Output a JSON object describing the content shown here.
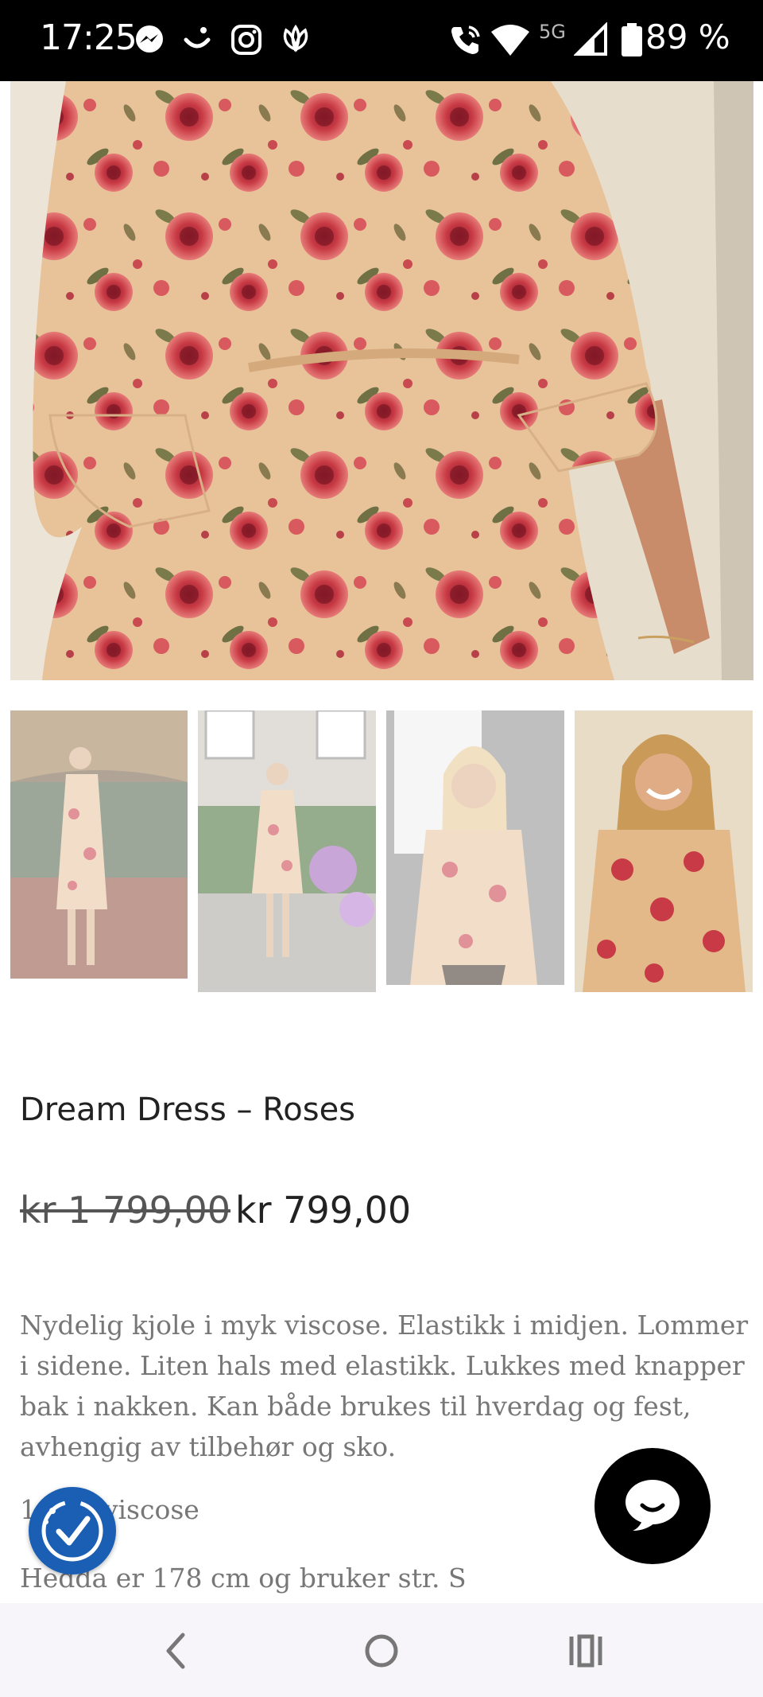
{
  "status_bar": {
    "time": "17:25",
    "network": "5G",
    "battery": "89 %",
    "left_icons": [
      "messenger-icon",
      "smile-icon",
      "instagram-icon",
      "flower-icon"
    ],
    "right_icons": [
      "wifi-call-icon",
      "wifi-icon",
      "signal-icon",
      "battery-icon"
    ]
  },
  "gallery": {
    "main_image": "floral-dress-closeup",
    "thumbnails": [
      "dress-outdoor-tropical",
      "dress-garden-walk",
      "dress-wall-portrait",
      "dress-smiling-portrait"
    ]
  },
  "product": {
    "title": "Dream Dress – Roses",
    "price_old": "kr 1 799,00",
    "price_new": "kr 799,00",
    "description": "Nydelig kjole i myk viscose. Elastikk i midjen. Lommer i sidene. Liten hals med elastikk. Lukkes med knapper bak i nakken. Kan både brukes til hverdag og fest, avhengig av tilbehør og sko.",
    "material": "100% viscose",
    "model_info": "Hedda er 178 cm og bruker str. S"
  },
  "colors": {
    "accent_blue": "#1a5fb4",
    "dress_base": "#e8c39a",
    "rose": "#c83a45"
  },
  "nav": {
    "icons": [
      "back-icon",
      "home-icon",
      "recents-icon"
    ]
  }
}
